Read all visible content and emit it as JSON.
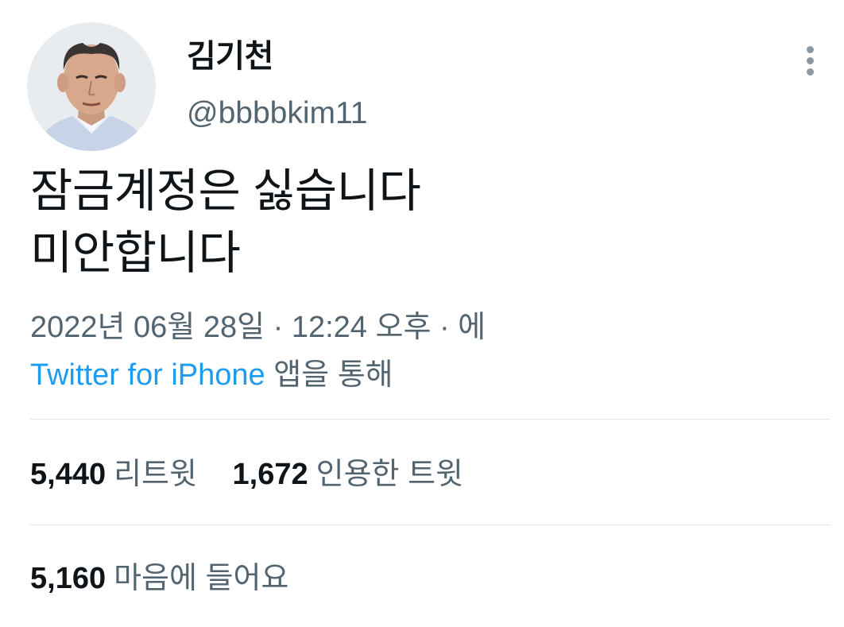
{
  "user": {
    "display_name": "김기천",
    "handle": "@bbbbkim11",
    "avatar_icon": "profile-photo"
  },
  "more_icon": "more-vertical-icon",
  "tweet": {
    "lines": [
      "잠금계정은 싫습니다",
      "미안합니다"
    ]
  },
  "meta": {
    "timestamp": "2022년 06월 28일 · 12:24 오후 · 에",
    "source": "Twitter for iPhone",
    "source_suffix": " 앱을 통해"
  },
  "stats": {
    "retweets": {
      "count": "5,440",
      "label": "리트윗"
    },
    "quotes": {
      "count": "1,672",
      "label": "인용한 트윗"
    },
    "likes": {
      "count": "5,160",
      "label": "마음에 들어요"
    }
  },
  "colors": {
    "text_primary": "#0f1419",
    "text_secondary": "#536471",
    "link": "#1d9bf0",
    "divider": "#dfe4e8"
  }
}
